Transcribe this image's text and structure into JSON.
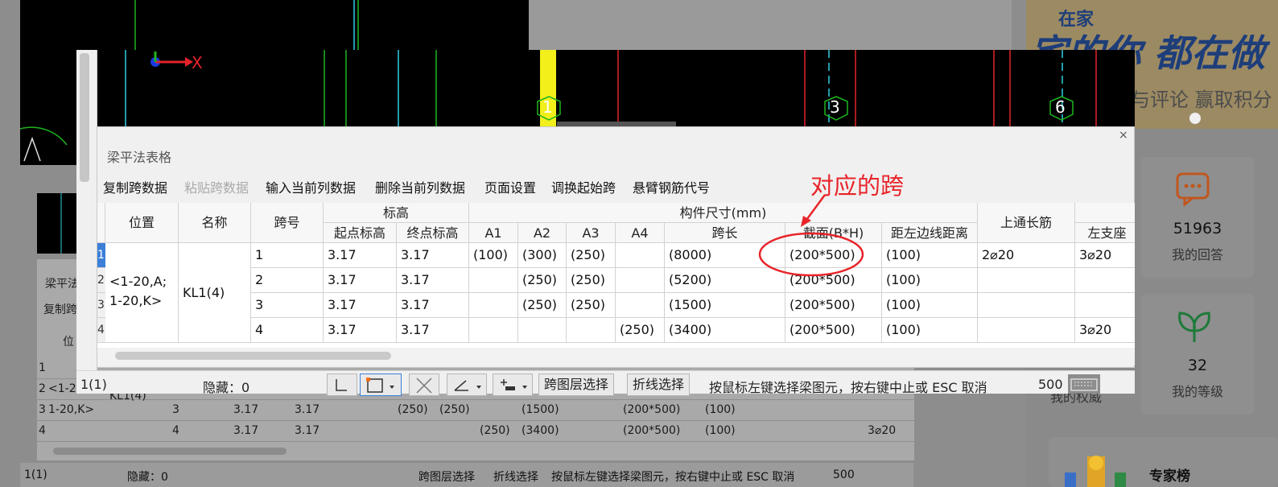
{
  "background": {
    "panel_title_partial": "梁平法",
    "panel_toolbar_partial": "复制跨",
    "header_partial": "位",
    "rows": [
      {
        "num": "1",
        "pos": "",
        "name": "",
        "span": "",
        "h1": "",
        "h2": "",
        "a2": "",
        "a3": "",
        "a4": "",
        "len": "",
        "sec": "",
        "dist": "",
        "left": ""
      },
      {
        "num": "2",
        "pos": "<1-2",
        "name": "",
        "span": "",
        "h1": "",
        "h2": "",
        "a2": "",
        "a3": "",
        "a4": "",
        "len": "",
        "sec": "",
        "dist": "",
        "left": ""
      },
      {
        "num": "3",
        "pos": "1-20,K>",
        "name": "KL1(4)",
        "span": "3",
        "h1": "3.17",
        "h2": "3.17",
        "a2": "(250)",
        "a3": "(250)",
        "a4": "",
        "len": "(1500)",
        "sec": "(200*500)",
        "dist": "(100)",
        "left": ""
      },
      {
        "num": "4",
        "pos": "",
        "name": "",
        "span": "4",
        "h1": "3.17",
        "h2": "3.17",
        "a2": "",
        "a3": "",
        "a4": "(250)",
        "len": "(3400)",
        "sec": "(200*500)",
        "dist": "(100)",
        "left": "3⌀20"
      }
    ],
    "status_left": "1(1)",
    "status_hidden": "隐藏：0",
    "status_btn1": "跨图层选择",
    "status_btn2": "折线选择",
    "status_msg": "按鼠标左键选择梁图元，按右键中止或 ESC 取消",
    "status_num": "500"
  },
  "right_panel": {
    "banner_line1": "在家",
    "banner_line2": "宅的你 都在做",
    "banner_line3": "与评论 赢取积分",
    "stats": [
      {
        "value": "51963",
        "label": "我的回答"
      },
      {
        "value": "32",
        "label": "我的等级"
      }
    ],
    "partial_label": "我的权威",
    "expert_title": "专家榜"
  },
  "canvas": {
    "axis_x_label": "X",
    "markers": [
      "1",
      "3",
      "6"
    ]
  },
  "dialog": {
    "title": "梁平法表格",
    "close": "×",
    "toolbar": [
      {
        "label": "复制跨数据",
        "enabled": true
      },
      {
        "label": "粘贴跨数据",
        "enabled": false
      },
      {
        "label": "输入当前列数据",
        "enabled": true
      },
      {
        "label": "删除当前列数据",
        "enabled": true
      },
      {
        "label": "页面设置",
        "enabled": true
      },
      {
        "label": "调换起始跨",
        "enabled": true
      },
      {
        "label": "悬臂钢筋代号",
        "enabled": true
      }
    ],
    "headers": {
      "position": "位置",
      "name": "名称",
      "span": "跨号",
      "elevation": "标高",
      "start_elev": "起点标高",
      "end_elev": "终点标高",
      "dimensions": "构件尺寸(mm)",
      "a1": "A1",
      "a2": "A2",
      "a3": "A3",
      "a4": "A4",
      "span_length": "跨长",
      "section": "截面(B*H)",
      "dist_left": "距左边线距离",
      "top_bar": "上通长筋",
      "left_support": "左支座"
    },
    "merged": {
      "position": "<1-20,A;\n1-20,K>",
      "name": "KL1(4)"
    },
    "rows": [
      {
        "num": "1",
        "span": "1",
        "start": "3.17",
        "end": "3.17",
        "a1": "(100)",
        "a2": "(300)",
        "a3": "(250)",
        "a4": "",
        "length": "(8000)",
        "section": "(200*500)",
        "dist": "(100)",
        "top": "2⌀20",
        "left": "3⌀20"
      },
      {
        "num": "2",
        "span": "2",
        "start": "3.17",
        "end": "3.17",
        "a1": "",
        "a2": "(250)",
        "a3": "(250)",
        "a4": "",
        "length": "(5200)",
        "section": "(200*500)",
        "dist": "(100)",
        "top": "",
        "left": ""
      },
      {
        "num": "3",
        "span": "3",
        "start": "3.17",
        "end": "3.17",
        "a1": "",
        "a2": "(250)",
        "a3": "(250)",
        "a4": "",
        "length": "(1500)",
        "section": "(200*500)",
        "dist": "(100)",
        "top": "",
        "left": ""
      },
      {
        "num": "4",
        "span": "4",
        "start": "3.17",
        "end": "3.17",
        "a1": "",
        "a2": "",
        "a3": "",
        "a4": "(250)",
        "length": "(3400)",
        "section": "(200*500)",
        "dist": "(100)",
        "top": "",
        "left": "3⌀20"
      }
    ],
    "annotation": "对应的跨",
    "annotation_color": "#e8242a"
  },
  "statusbar": {
    "left": "1(1)",
    "hidden": "隐藏：0",
    "btn_layer": "跨图层选择",
    "btn_polyline": "折线选择",
    "message": "按鼠标左键选择梁图元，按右键中止或 ESC 取消",
    "number": "500"
  }
}
